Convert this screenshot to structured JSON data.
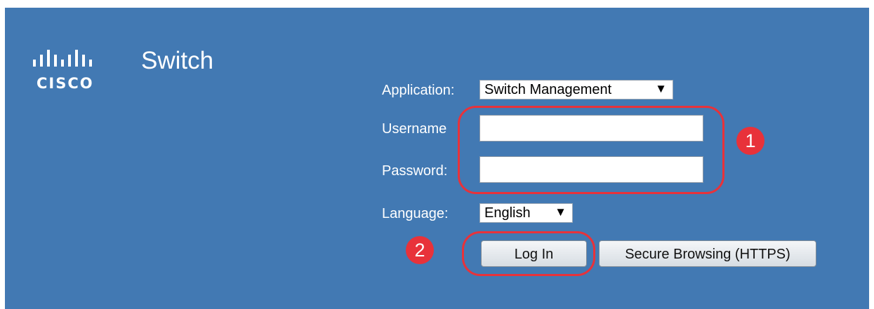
{
  "header": {
    "logo_text": "CISCO",
    "product_title": "Switch"
  },
  "form": {
    "application": {
      "label": "Application:",
      "value": "Switch Management"
    },
    "username": {
      "label": "Username",
      "value": "",
      "placeholder": ""
    },
    "password": {
      "label": "Password:",
      "value": "",
      "placeholder": ""
    },
    "language": {
      "label": "Language:",
      "value": "English"
    },
    "login_button": "Log In",
    "secure_button": "Secure Browsing (HTTPS)"
  },
  "annotations": {
    "step1": "1",
    "step2": "2",
    "color": "#e8323a"
  },
  "colors": {
    "background": "#4279b3",
    "text": "#ffffff"
  },
  "icons": {
    "logo": "cisco-logo-bars-icon",
    "dropdown": "triangle-down-icon"
  }
}
